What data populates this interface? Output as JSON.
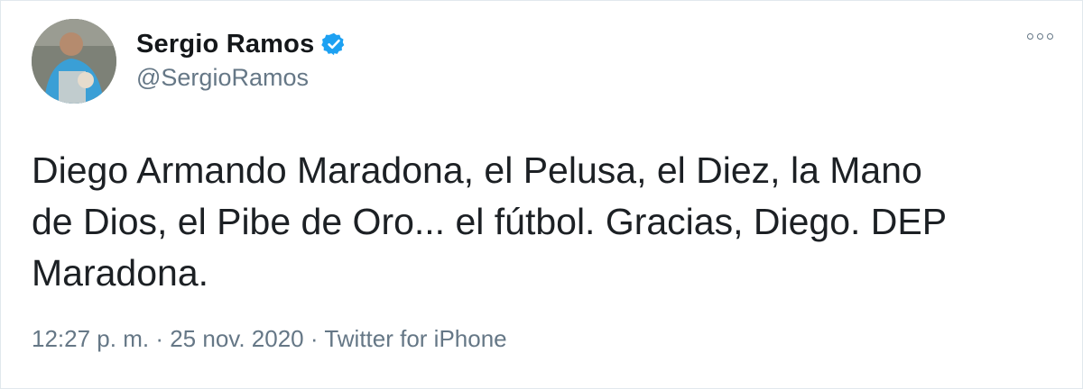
{
  "tweet": {
    "display_name": "Sergio Ramos",
    "handle": "@SergioRamos",
    "text_lines": [
      "Diego Armando Maradona, el Pelusa, el Diez, la Mano",
      "de Dios, el Pibe de Oro... el fútbol. Gracias, Diego. DEP",
      "Maradona."
    ],
    "time": "12:27 p. m.",
    "separator": "·",
    "date": "25 nov. 2020",
    "source": "Twitter for iPhone"
  },
  "colors": {
    "verified_badge": "#1da1f2",
    "secondary_text": "#657786"
  },
  "icons": {
    "verified": "verified-badge-icon",
    "more": "more-options-icon"
  }
}
